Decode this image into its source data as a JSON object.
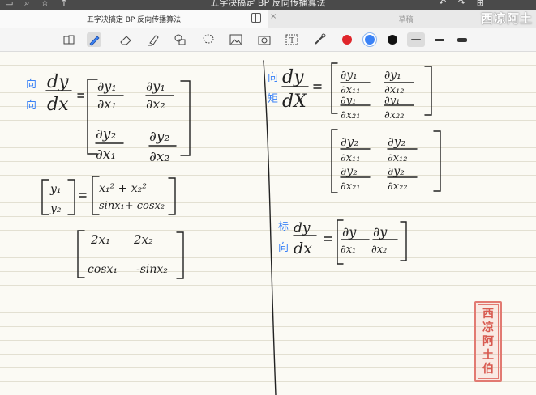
{
  "system": {
    "title": "五字决搞定 BP 反向传播算法"
  },
  "tabs": [
    {
      "label": "五字决搞定 BP 反向传播算法",
      "active": true
    },
    {
      "label": "草稿",
      "active": false
    }
  ],
  "toolbar": {
    "tools": [
      "page-layout-icon",
      "pen-icon",
      "eraser-icon",
      "highlighter-icon",
      "shapes-icon",
      "lasso-icon",
      "image-icon",
      "camera-icon",
      "text-icon",
      "laser-pointer-icon"
    ],
    "colors": [
      "#e0262b",
      "#3b82f6",
      "#111111"
    ],
    "selected_color": "#3b82f6",
    "stroke_widths": [
      "thin",
      "medium",
      "thick"
    ],
    "selected_width": "thin"
  },
  "watermark": "西凉阿土",
  "seal": [
    "西",
    "凉",
    "阿",
    "土",
    "伯"
  ],
  "ink": {
    "blue_notes": [
      "向",
      "向",
      "向",
      "矩",
      "标",
      "向"
    ]
  }
}
